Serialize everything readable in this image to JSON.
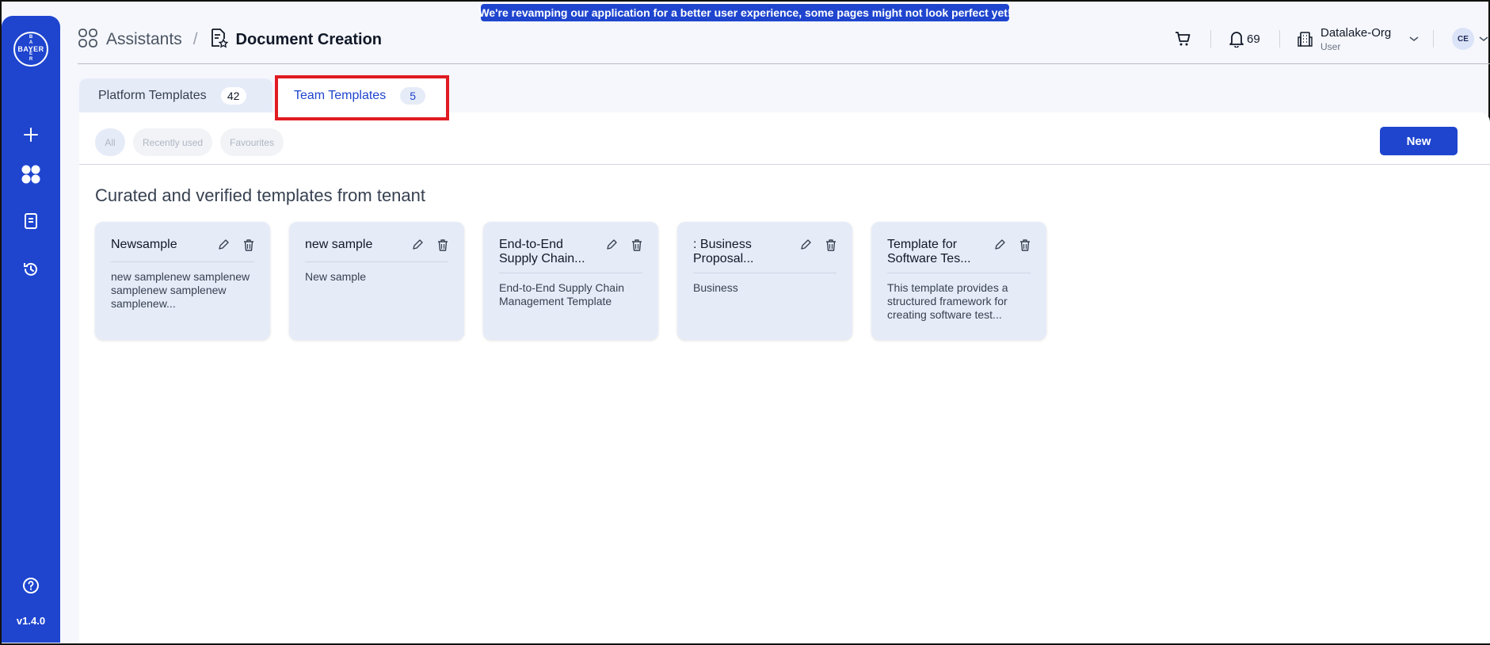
{
  "announcement": "We're revamping our application for a better user experience, some pages might not look perfect yet!",
  "sidebar": {
    "logo_text": "BAYER",
    "version": "v1.4.0"
  },
  "header": {
    "breadcrumb_root": "Assistants",
    "breadcrumb_separator": "/",
    "page_title": "Document Creation",
    "notification_count": "69",
    "org_name": "Datalake-Org",
    "org_role": "User",
    "avatar_initials": "CE"
  },
  "tabs": [
    {
      "label": "Platform Templates",
      "count": "42"
    },
    {
      "label": "Team Templates",
      "count": "5"
    }
  ],
  "filters": {
    "all": "All",
    "recent": "Recently used",
    "favourites": "Favourites"
  },
  "new_button": "New",
  "section_title": "Curated and verified templates from tenant",
  "cards": [
    {
      "title": "Newsample",
      "description": "new samplenew samplenew samplenew samplenew samplenew..."
    },
    {
      "title": "new sample",
      "description": "New sample"
    },
    {
      "title": "End-to-End Supply Chain...",
      "description": "End-to-End Supply Chain Management Template"
    },
    {
      "title": ": Business Proposal...",
      "description": "Business"
    },
    {
      "title": "Template for Software Tes...",
      "description": "This template provides a structured framework for creating software test..."
    }
  ],
  "colors": {
    "accent": "#1f45cf",
    "highlight_box": "#e11b22",
    "card_bg": "#e6ebf8"
  }
}
